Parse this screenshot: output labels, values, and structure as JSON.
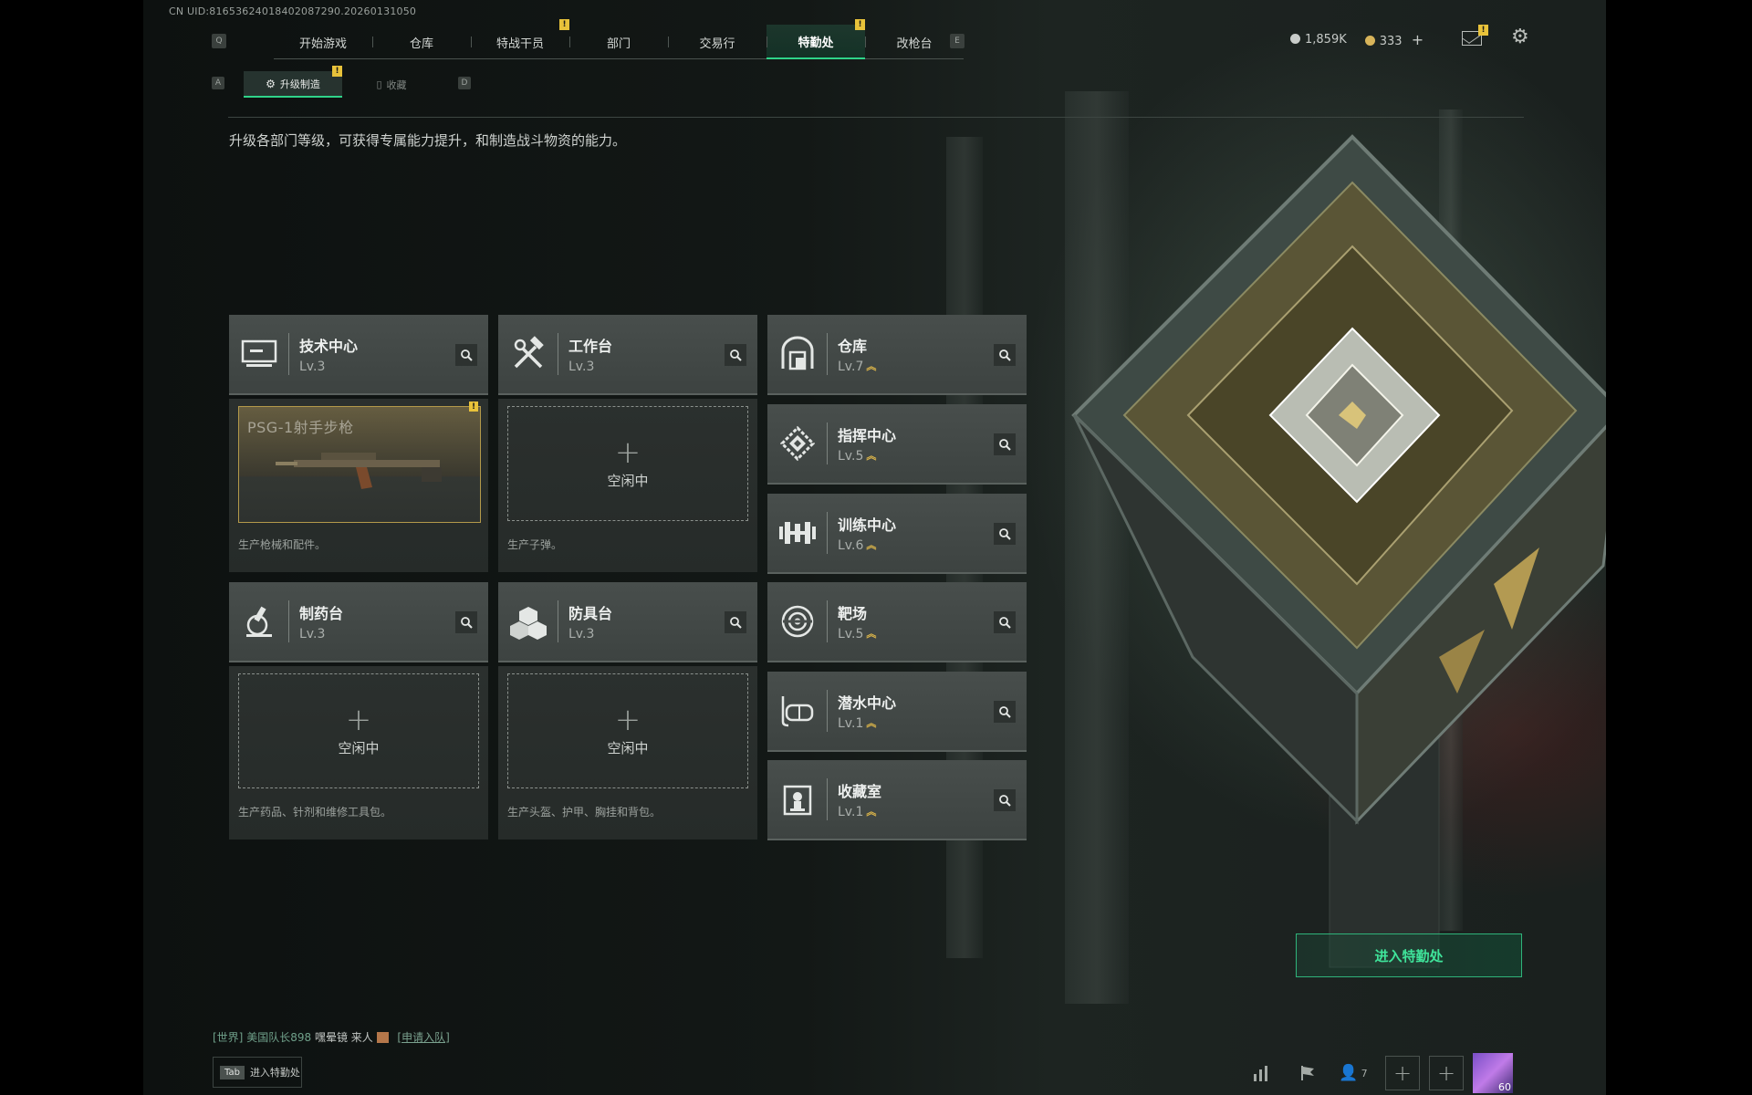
{
  "uid_text": "CN UID:8165362401840208729⁠O.202601310S0",
  "nav": {
    "key_left": "Q",
    "key_right": "E",
    "tabs": [
      {
        "label": "开始游戏",
        "badge": ""
      },
      {
        "label": "仓库",
        "badge": ""
      },
      {
        "label": "特战干员",
        "badge": "!"
      },
      {
        "label": "部门",
        "badge": ""
      },
      {
        "label": "交易行",
        "badge": ""
      },
      {
        "label": "特勤处",
        "badge": "!",
        "active": true
      },
      {
        "label": "改枪台",
        "badge": ""
      }
    ]
  },
  "currency": {
    "silver": "1,859K",
    "gold": "333",
    "add": "+",
    "mail_badge": "!"
  },
  "subnav": {
    "key_left": "A",
    "key_right": "D",
    "tabs": [
      {
        "label": "升级制造",
        "active": true,
        "badge": "!"
      },
      {
        "label": "收藏",
        "active": false
      }
    ]
  },
  "description": "升级各部门等级，可获得专属能力提升，和制造战斗物资的能力。",
  "departments": {
    "tech": {
      "name": "技术中心",
      "level": "Lv.3",
      "icon": "monitor-icon"
    },
    "workbench": {
      "name": "工作台",
      "level": "Lv.3",
      "icon": "hammer-wrench-icon"
    },
    "pharmacy": {
      "name": "制药台",
      "level": "Lv.3",
      "icon": "microscope-icon"
    },
    "armor": {
      "name": "防具台",
      "level": "Lv.3",
      "icon": "cubes-icon"
    },
    "warehouse": {
      "name": "仓库",
      "level": "Lv.7",
      "icon": "vault-icon"
    },
    "command": {
      "name": "指挥中心",
      "level": "Lv.5",
      "icon": "chip-icon"
    },
    "training": {
      "name": "训练中心",
      "level": "Lv.6",
      "icon": "dumbbell-icon"
    },
    "range": {
      "name": "靶场",
      "level": "Lv.5",
      "icon": "target-icon"
    },
    "dive": {
      "name": "潜水中心",
      "level": "Lv.1",
      "icon": "diving-mask-icon"
    },
    "collection": {
      "name": "收藏室",
      "level": "Lv.1",
      "icon": "trophy-icon"
    }
  },
  "slots": {
    "tech": {
      "item": "PSG-1射手步枪",
      "desc": "生产枪械和配件。",
      "badge": "!"
    },
    "workbench": {
      "status": "空闲中",
      "desc": "生产子弹。"
    },
    "pharmacy": {
      "status": "空闲中",
      "desc": "生产药品、针剂和维修工具包。"
    },
    "armor": {
      "status": "空闲中",
      "desc": "生产头盔、护甲、胸挂和背包。"
    }
  },
  "enter_button": "进入特勤处",
  "chat": {
    "channel": "[世界]",
    "sender": "美国队长898",
    "message": "嘿晕镜 来人",
    "join": "[申请入队]"
  },
  "tab_hint": {
    "key": "Tab",
    "label": "进入特勤处"
  },
  "bottom_bar": {
    "friends_count": "7",
    "player_level": "60"
  },
  "colors": {
    "accent": "#2fd389",
    "badge": "#e8c23a",
    "upgrade": "#e0b84a"
  }
}
